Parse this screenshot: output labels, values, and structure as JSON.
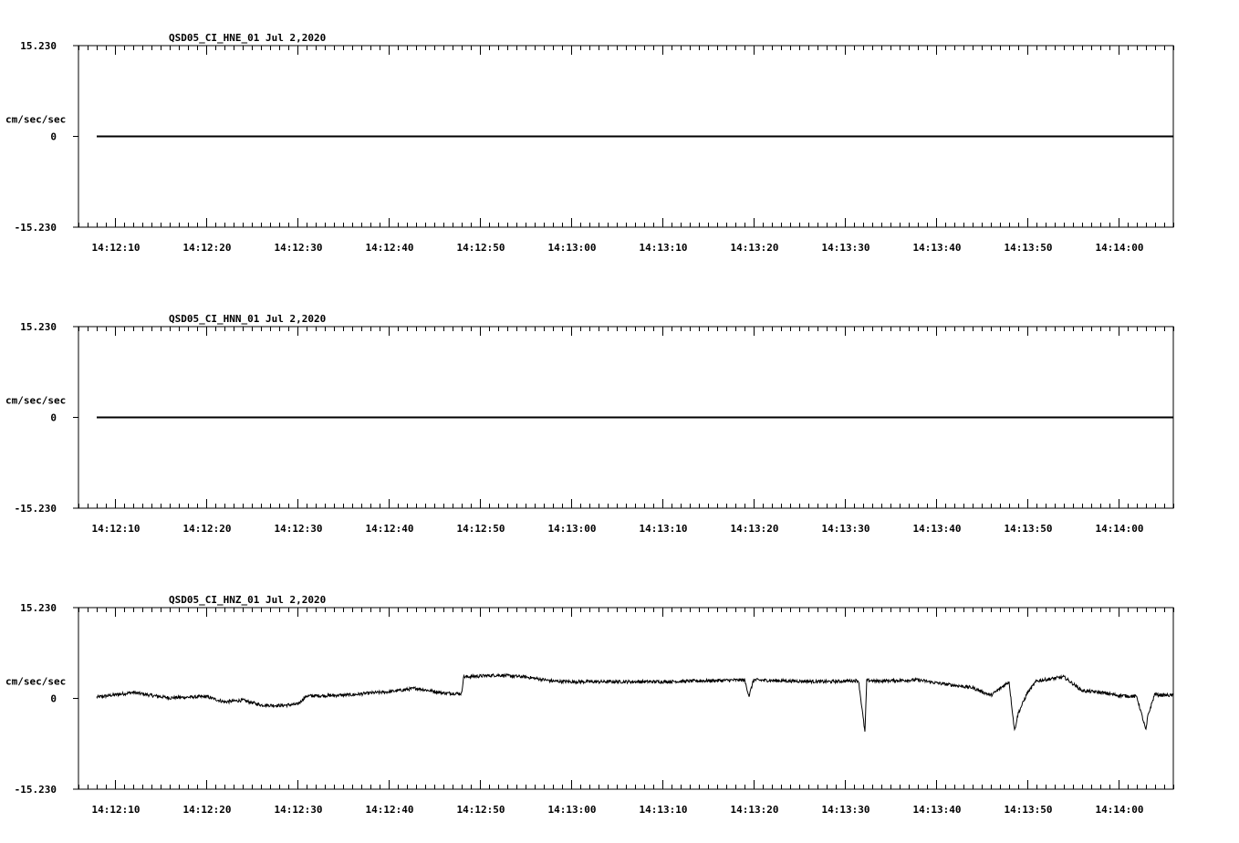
{
  "chart_data": [
    {
      "type": "line",
      "title": "QSD05_CI_HNE_01  Jul 2,2020",
      "ylabel": "cm/sec/sec",
      "ytick_labels": [
        "15.230",
        "0",
        "-15.230"
      ],
      "ylim": [
        -15.23,
        15.23
      ],
      "xlim": [
        "14:12:06",
        "14:14:06"
      ],
      "xtick_labels": [
        "14:12:10",
        "14:12:20",
        "14:12:30",
        "14:12:40",
        "14:12:50",
        "14:13:00",
        "14:13:10",
        "14:13:20",
        "14:13:30",
        "14:13:40",
        "14:13:50",
        "14:14:00"
      ],
      "grid": false,
      "series": [
        {
          "x": [
            "14:12:08",
            "14:14:06"
          ],
          "y": [
            0,
            0
          ]
        }
      ]
    },
    {
      "type": "line",
      "title": "QSD05_CI_HNN_01  Jul 2,2020",
      "ylabel": "cm/sec/sec",
      "ytick_labels": [
        "15.230",
        "0",
        "-15.230"
      ],
      "ylim": [
        -15.23,
        15.23
      ],
      "xlim": [
        "14:12:06",
        "14:14:06"
      ],
      "xtick_labels": [
        "14:12:10",
        "14:12:20",
        "14:12:30",
        "14:12:40",
        "14:12:50",
        "14:13:00",
        "14:13:10",
        "14:13:20",
        "14:13:30",
        "14:13:40",
        "14:13:50",
        "14:14:00"
      ],
      "grid": false,
      "series": [
        {
          "x": [
            "14:12:08",
            "14:14:06"
          ],
          "y": [
            0,
            0
          ]
        }
      ]
    },
    {
      "type": "line",
      "title": "QSD05_CI_HNZ_01  Jul 2,2020",
      "ylabel": "cm/sec/sec",
      "ytick_labels": [
        "15.230",
        "0",
        "-15.230"
      ],
      "ylim": [
        -15.23,
        15.23
      ],
      "xlim": [
        "14:12:06",
        "14:14:06"
      ],
      "xtick_labels": [
        "14:12:10",
        "14:12:20",
        "14:12:30",
        "14:12:40",
        "14:12:50",
        "14:13:00",
        "14:13:10",
        "14:13:20",
        "14:13:30",
        "14:13:40",
        "14:13:50",
        "14:14:00"
      ],
      "grid": false,
      "series": [
        {
          "x": [
            "14:12:08",
            "14:12:12",
            "14:12:14",
            "14:12:16",
            "14:12:20",
            "14:12:22",
            "14:12:24",
            "14:12:26",
            "14:12:28",
            "14:12:30",
            "14:12:31",
            "14:12:34",
            "14:12:36",
            "14:12:38",
            "14:12:40",
            "14:12:43",
            "14:12:46",
            "14:12:48",
            "14:12:48.2",
            "14:12:52",
            "14:12:55",
            "14:12:58",
            "14:13:00",
            "14:13:10",
            "14:13:16",
            "14:13:19",
            "14:13:19.5",
            "14:13:20",
            "14:13:22",
            "14:13:28",
            "14:13:31.5",
            "14:13:32.2",
            "14:13:32.4",
            "14:13:33",
            "14:13:33.2",
            "14:13:38",
            "14:13:40",
            "14:13:44",
            "14:13:46",
            "14:13:48",
            "14:13:48.2",
            "14:13:48.6",
            "14:13:49",
            "14:13:50",
            "14:13:51",
            "14:13:54",
            "14:13:56",
            "14:13:58",
            "14:14:00",
            "14:14:02",
            "14:14:03",
            "14:14:03.2",
            "14:14:04",
            "14:14:04.2",
            "14:14:06"
          ],
          "y": [
            0.2,
            1.0,
            0.5,
            0.1,
            0.3,
            -0.6,
            -0.3,
            -1.1,
            -1.2,
            -1.0,
            0.4,
            0.5,
            0.6,
            0.9,
            1.1,
            1.7,
            0.9,
            0.8,
            3.6,
            3.9,
            3.6,
            2.9,
            2.8,
            2.8,
            3.0,
            3.1,
            0.4,
            3.1,
            3.0,
            2.8,
            3.0,
            -5.7,
            3.0,
            3.0,
            2.9,
            3.1,
            2.6,
            1.8,
            0.5,
            2.8,
            0.0,
            -5.4,
            -2.5,
            0.9,
            2.9,
            3.6,
            1.3,
            1.0,
            0.5,
            0.3,
            -5.4,
            -3.0,
            0.9,
            0.6,
            0.5
          ]
        }
      ]
    }
  ]
}
